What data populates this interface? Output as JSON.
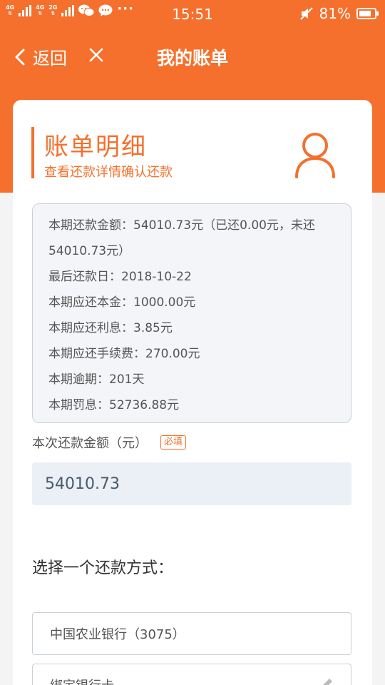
{
  "status_bar": {
    "net_1": "4G",
    "net_2": "4G",
    "net_3": "2G",
    "dots": "···",
    "time": "15:51",
    "battery": "81%",
    "battery_level": 0.81
  },
  "nav": {
    "back_label": "返回",
    "title": "我的账单"
  },
  "card": {
    "title": "账单明细",
    "subtitle": "查看还款详情确认还款",
    "details": [
      "本期还款金额：54010.73元（已还0.00元，未还54010.73元）",
      "最后还款日：2018-10-22",
      "本期应还本金：1000.00元",
      "本期应还利息：3.85元",
      "本期应还手续费：270.00元",
      "本期逾期：201天",
      "本期罚息：52736.88元"
    ],
    "amount_label": "本次还款金额（元）",
    "required_tag": "必填",
    "amount_value": "54010.73",
    "method_title": "选择一个还款方式：",
    "methods": [
      "中国农业银行（3075）",
      "绑定银行卡"
    ]
  },
  "colors": {
    "accent": "#f5702c",
    "info_bg": "#f3f5f8",
    "input_bg": "#ebeff6"
  }
}
